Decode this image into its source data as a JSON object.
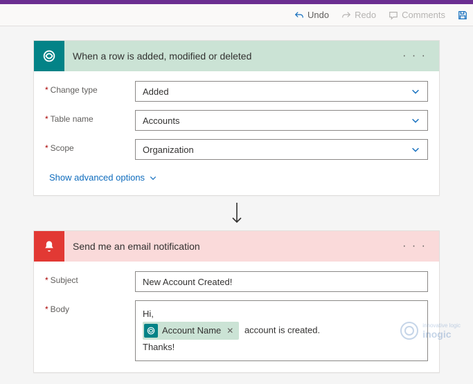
{
  "toolbar": {
    "undo": "Undo",
    "redo": "Redo",
    "comments": "Comments"
  },
  "trigger": {
    "title": "When a row is added, modified or deleted",
    "fields": {
      "change_type": {
        "label": "Change type",
        "value": "Added"
      },
      "table_name": {
        "label": "Table name",
        "value": "Accounts"
      },
      "scope": {
        "label": "Scope",
        "value": "Organization"
      }
    },
    "advanced_link": "Show advanced options"
  },
  "action": {
    "title": "Send me an email notification",
    "fields": {
      "subject": {
        "label": "Subject",
        "value": "New Account Created!"
      },
      "body": {
        "label": "Body",
        "line1": "Hi,",
        "token_label": "Account Name",
        "after_token": " account is created.",
        "line3": "Thanks!"
      }
    }
  },
  "watermark": {
    "brand": "inogic",
    "tag": "innovative logic"
  }
}
